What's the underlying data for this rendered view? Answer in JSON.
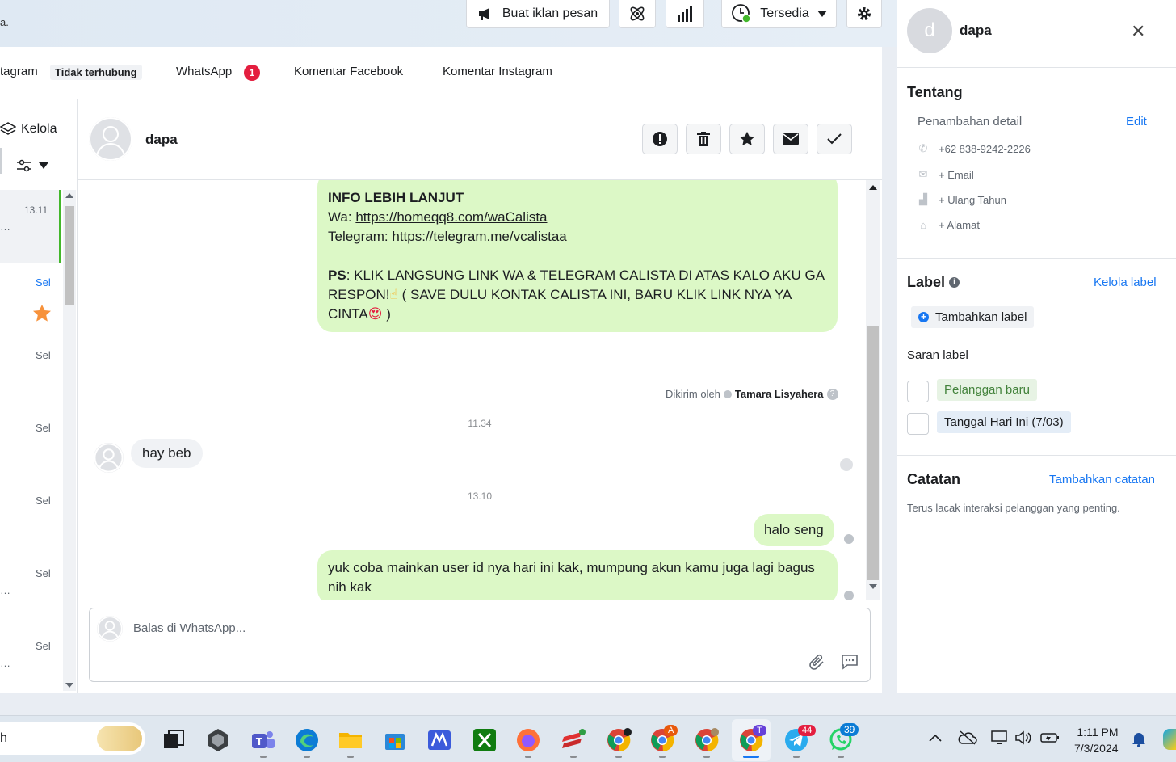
{
  "topbar": {
    "truncated_text": "a.",
    "ad_button": "Buat iklan pesan",
    "status_label": "Tersedia"
  },
  "tabs": {
    "instagram": "tagram",
    "instagram_status": "Tidak terhubung",
    "whatsapp": "WhatsApp",
    "whatsapp_badge": "1",
    "fb_comments": "Komentar Facebook",
    "ig_comments": "Komentar Instagram"
  },
  "left_list": {
    "manage": "Kelola",
    "first_time": "13.11",
    "items": [
      "Sel",
      "Sel",
      "Sel",
      "Sel",
      "Sel",
      "Sel"
    ],
    "ellipsis": "…"
  },
  "conversation": {
    "contact_name": "dapa",
    "messages": {
      "info_title": "INFO LEBIH LANJUT",
      "wa_label": "Wa: ",
      "wa_link": "https://homeqq8.com/waCalista",
      "tg_label": "Telegram: ",
      "tg_link": "https://telegram.me/vcalistaa",
      "ps_label": "PS",
      "ps_text": ": KLIK LANGSUNG LINK  WA & TELEGRAM CALISTA DI ATAS KALO AKU GA RESPON!",
      "ps_text2": " ( SAVE DULU KONTAK CALISTA INI, BARU KLIK LINK NYA YA CINTA",
      "ps_text3": " )",
      "emoji_finger": "☝",
      "emoji_heart_eyes": "😍",
      "sent_by_label": "Dikirim oleh",
      "sent_by_name": "Tamara Lisyahera",
      "time_1": "11.34",
      "in_msg": "hay beb",
      "time_2": "13.10",
      "out_msg_1": "halo seng",
      "out_msg_2": "yuk coba mainkan user id nya hari ini kak, mumpung akun kamu juga lagi bagus nih kak"
    },
    "composer_placeholder": "Balas di WhatsApp..."
  },
  "right_panel": {
    "contact_initial": "d",
    "contact_name": "dapa",
    "about_title": "Tentang",
    "details_label": "Penambahan detail",
    "edit": "Edit",
    "phone": "+62 838-9242-2226",
    "email": "+ Email",
    "birthday": "+ Ulang Tahun",
    "address": "+ Alamat",
    "label_title": "Label",
    "manage_label": "Kelola label",
    "add_label": "Tambahkan label",
    "suggest_label": "Saran label",
    "suggest_1": "Pelanggan baru",
    "suggest_2": "Tanggal Hari Ini (7/03)",
    "notes_title": "Catatan",
    "add_note": "Tambahkan catatan",
    "notes_desc": "Terus lacak interaksi pelanggan yang penting."
  },
  "taskbar": {
    "search_text": "h",
    "badge_44": "44",
    "badge_39": "39",
    "badge_A": "A",
    "badge_T": "T",
    "time": "1:11 PM",
    "date": "7/3/2024"
  },
  "colors": {
    "accent": "#1877f2",
    "out_bubble": "#dcf8c6",
    "badge_red": "#e41e3f",
    "active_green": "#42b72a"
  }
}
